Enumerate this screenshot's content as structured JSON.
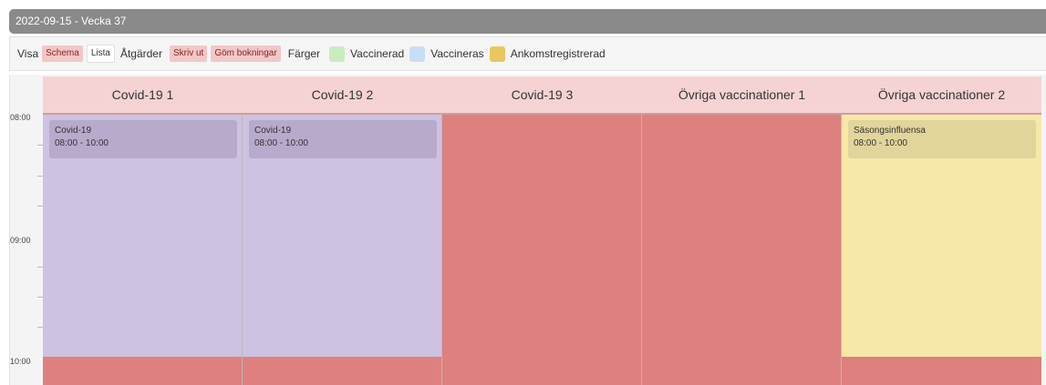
{
  "header": {
    "title": "2022-09-15 - Vecka 37"
  },
  "toolbar": {
    "visa_label": "Visa",
    "schema_button": "Schema",
    "lista_button": "Lista",
    "atgarder_label": "Åtgärder",
    "skriv_ut_button": "Skriv ut",
    "gom_bokningar_button": "Göm bokningar",
    "farger_label": "Färger",
    "legend": [
      {
        "label": "Vaccinerad",
        "color": "#c8ecc0"
      },
      {
        "label": "Vaccineras",
        "color": "#c7dff5"
      },
      {
        "label": "Ankomstregistrerad",
        "color": "#e8c75e"
      }
    ]
  },
  "calendar": {
    "times": [
      "08:00",
      "09:00",
      "10:00"
    ],
    "columns": [
      {
        "title": "Covid-19 1",
        "top_color": "#cdc2e1",
        "bottom_color": "#de807d",
        "event": {
          "title": "Covid-19",
          "time": "08:00 - 10:00",
          "color": "#b8aacb"
        }
      },
      {
        "title": "Covid-19 2",
        "top_color": "#cdc2e1",
        "bottom_color": "#de807d",
        "event": {
          "title": "Covid-19",
          "time": "08:00 - 10:00",
          "color": "#b8aacb"
        }
      },
      {
        "title": "Covid-19 3",
        "top_color": "#de807d",
        "bottom_color": "#de807d",
        "event": null
      },
      {
        "title": "Övriga vaccinationer 1",
        "top_color": "#de807d",
        "bottom_color": "#de807d",
        "event": null
      },
      {
        "title": "Övriga vaccinationer 2",
        "top_color": "#f7e7a9",
        "bottom_color": "#de807d",
        "event": {
          "title": "Säsongsinfluensa",
          "time": "08:00 - 10:00",
          "color": "#e1d59c"
        }
      }
    ]
  }
}
